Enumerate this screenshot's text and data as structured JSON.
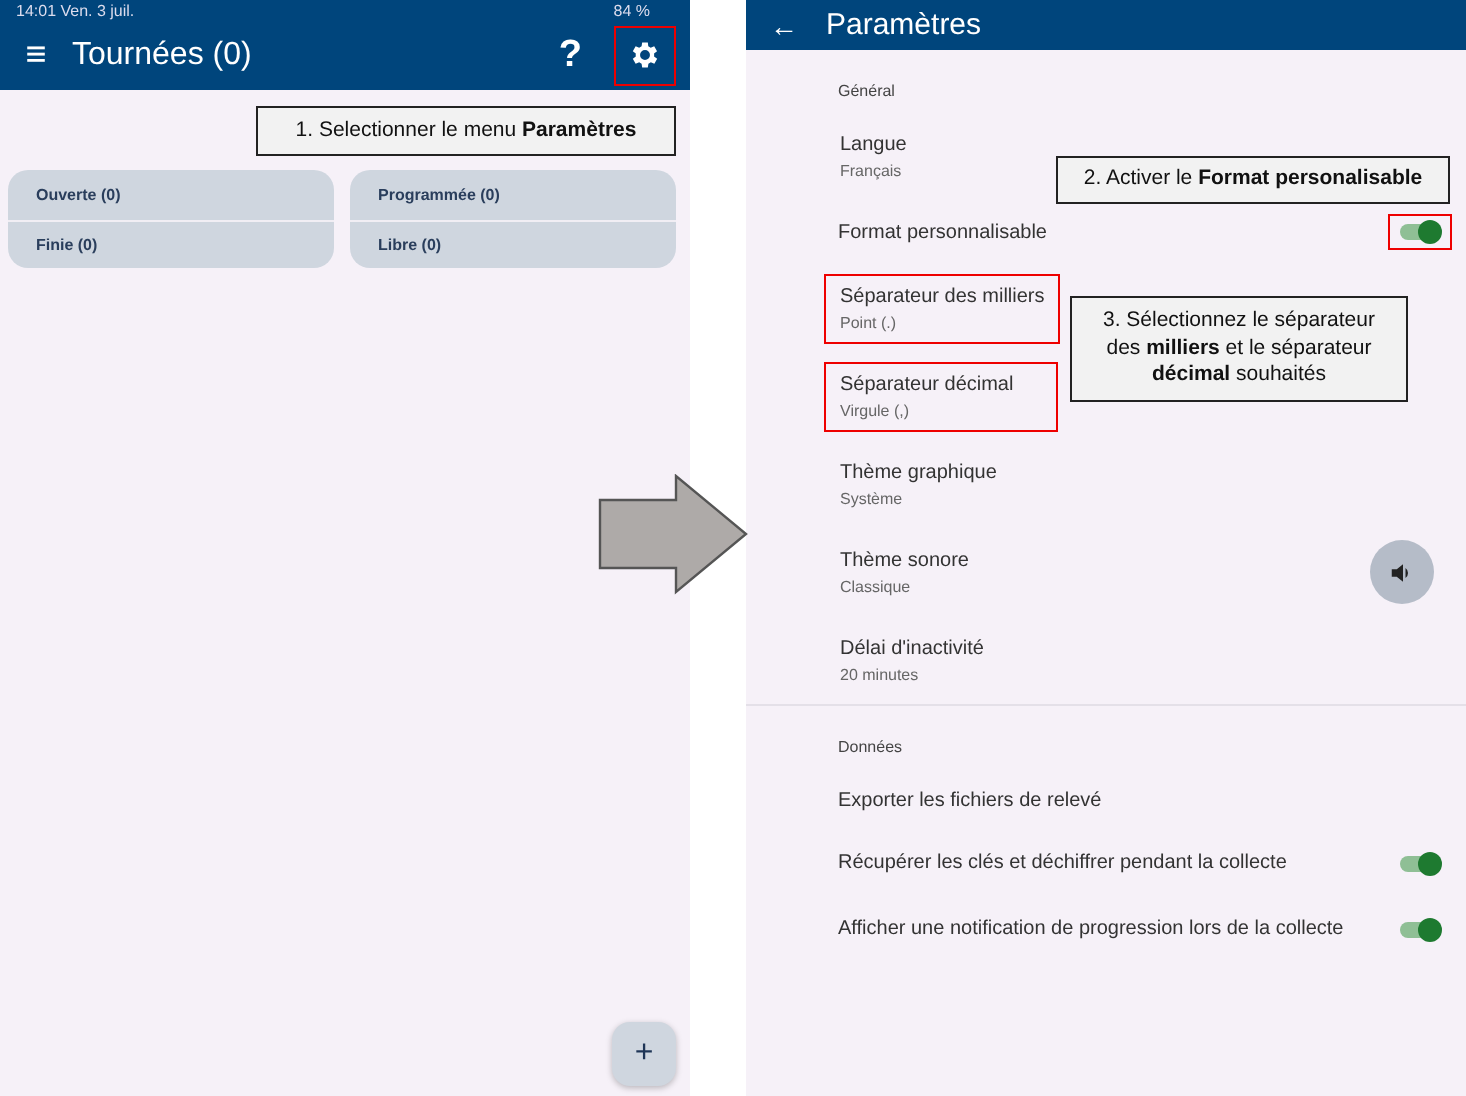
{
  "left_screen": {
    "status_bar": {
      "time": "14:01  Ven. 3 juil.",
      "battery": "84 %"
    },
    "app_bar": {
      "menu_icon": "≡",
      "title": "Tournées (0)",
      "help": "?",
      "settings_highlighted": true
    },
    "callout": {
      "number": "1.",
      "text": "Selectionner le menu **Paramètres**"
    },
    "cards": [
      {
        "rows": [
          "Ouverte (0)",
          "Finie (0)"
        ]
      },
      {
        "rows": [
          "Programmée (0)",
          "Libre (0)"
        ]
      }
    ],
    "fab": "+"
  },
  "right_screen": {
    "app_bar": {
      "back": "←",
      "title": "Paramètres"
    },
    "sections": [
      {
        "title": "Général",
        "items": [
          {
            "kind": "text",
            "title": "Langue",
            "value": "Français",
            "highlighted": false
          },
          {
            "kind": "switch",
            "title": "Format personnalisable",
            "on": true,
            "highlighted": true
          },
          {
            "kind": "text",
            "title": "Séparateur des milliers",
            "value": "Point (.)",
            "highlighted": true
          },
          {
            "kind": "text",
            "title": "Séparateur décimal",
            "value": "Virgule (,)",
            "highlighted": true
          },
          {
            "kind": "text",
            "title": "Thème graphique",
            "value": "Système",
            "highlighted": false
          },
          {
            "kind": "sound",
            "title": "Thème sonore",
            "value": "Classique",
            "highlighted": false
          },
          {
            "kind": "text",
            "title": "Délai d'inactivité",
            "value": "20 minutes",
            "highlighted": false
          }
        ]
      },
      {
        "title": "Données",
        "items": [
          {
            "kind": "action",
            "title": "Exporter les fichiers de relevé"
          },
          {
            "kind": "switch",
            "title": "Récupérer les clés et déchiffrer pendant la collecte",
            "on": true
          },
          {
            "kind": "switch",
            "title": "Afficher une notification de progression lors de la collecte",
            "on": true
          }
        ]
      }
    ],
    "callouts": [
      "2. Activer le **Format personalisable**",
      "3. Sélectionnez le séparateur des **milliers** et le séparateur **décimal** souhaités"
    ]
  }
}
